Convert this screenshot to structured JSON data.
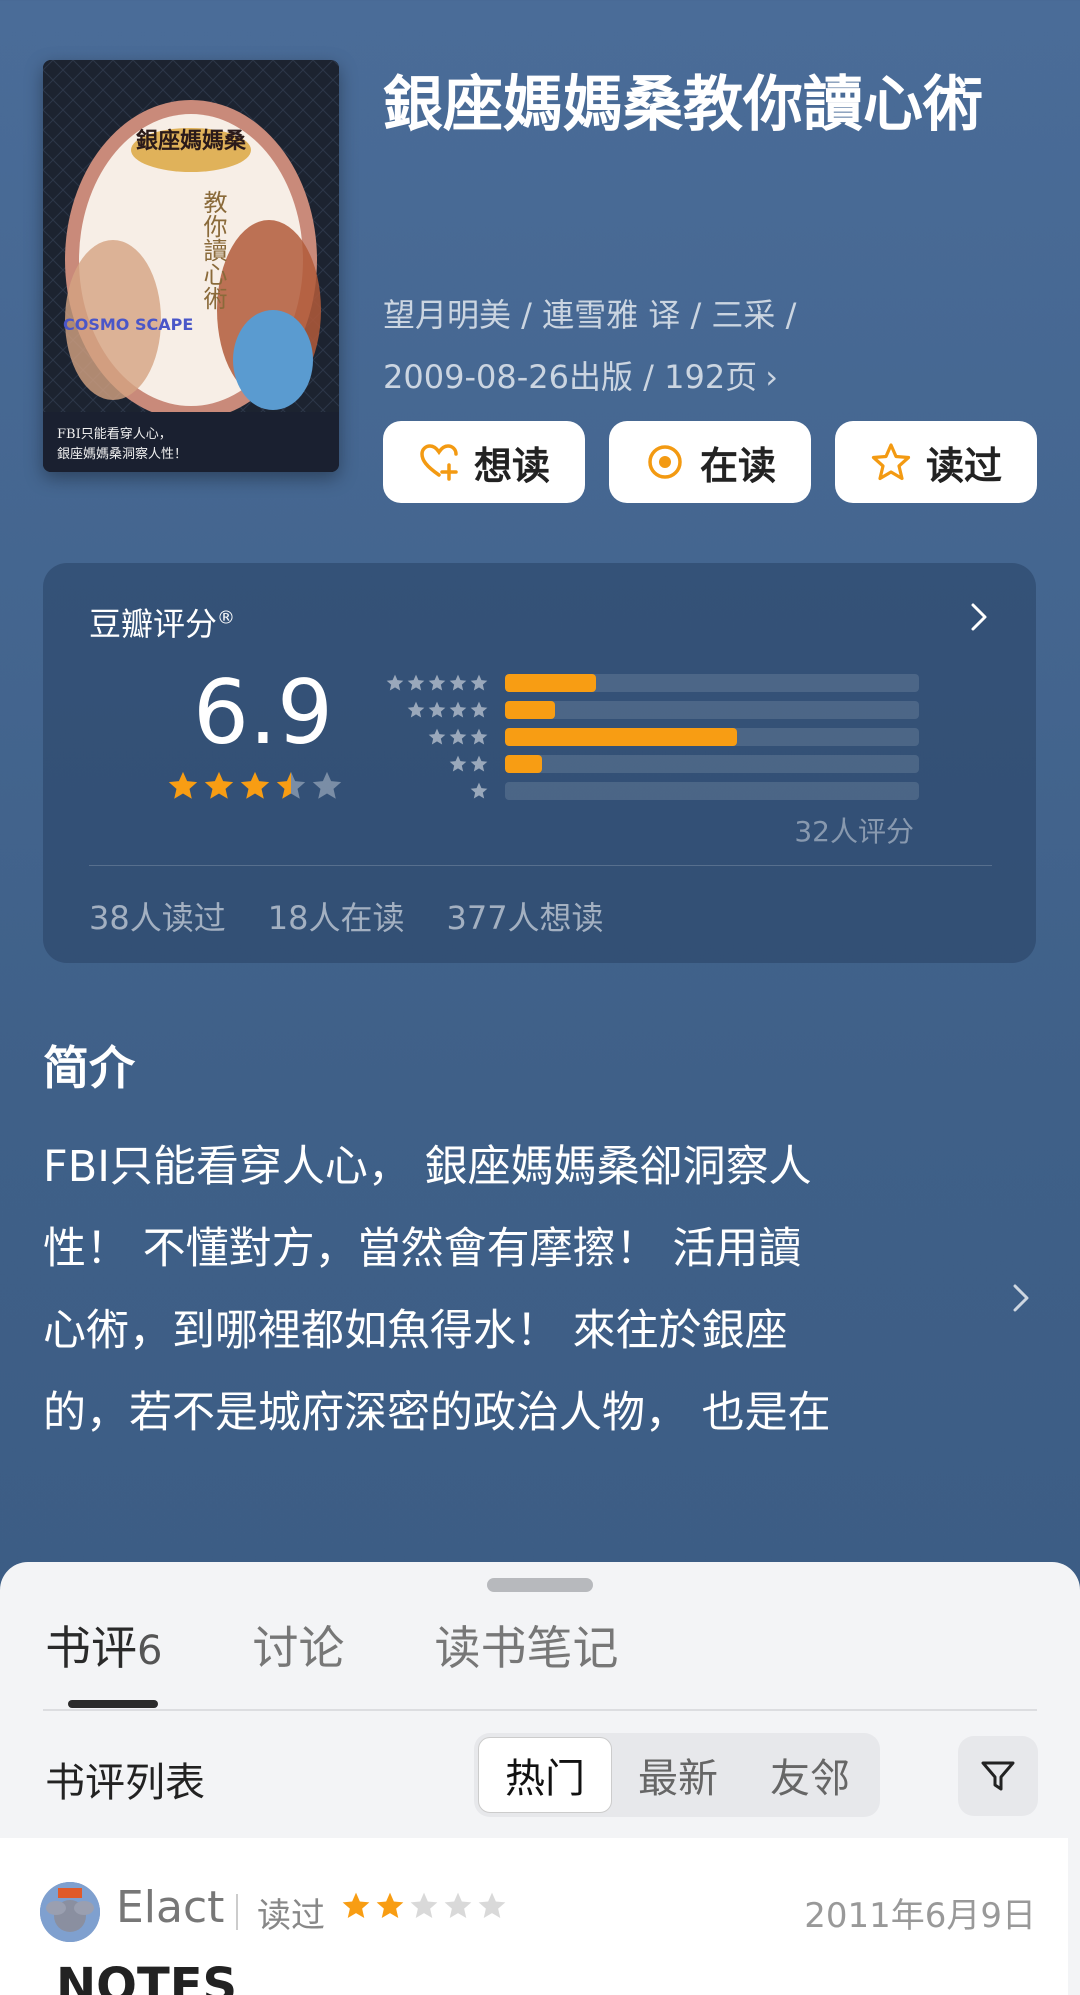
{
  "book": {
    "title": "銀座媽媽桑教你讀心術",
    "meta_line1": "望月明美 / 連雪雅 译 / 三采 /",
    "meta_line2": "2009-08-26出版 / 192页",
    "meta_chevron": "›",
    "cover": {
      "title_text": "銀座媽媽桑",
      "subtitle_text": "教你讀心術",
      "logo_text": "COSMO SCAPE",
      "tagline_line1": "FBI只能看穿人心，",
      "tagline_line2": "銀座媽媽桑洞察人性！"
    }
  },
  "actions": [
    {
      "label": "想读",
      "icon": "heart-plus-icon"
    },
    {
      "label": "在读",
      "icon": "target-icon"
    },
    {
      "label": "读过",
      "icon": "star-outline-icon"
    }
  ],
  "rating": {
    "label": "豆瓣评分",
    "registered_mark": "®",
    "score": "6.9",
    "score_stars": 3.5,
    "distribution": [
      {
        "stars": 5,
        "percent": 22
      },
      {
        "stars": 4,
        "percent": 12
      },
      {
        "stars": 3,
        "percent": 56
      },
      {
        "stars": 2,
        "percent": 9
      },
      {
        "stars": 1,
        "percent": 0
      }
    ],
    "count_text": "32人评分",
    "stats": [
      "38人读过",
      "18人在读",
      "377人想读"
    ]
  },
  "intro": {
    "heading": "简介",
    "lines": [
      "FBI只能看穿人心， 銀座媽媽桑卻洞察人",
      "性！ 不懂對方，當然會有摩擦！ 活用讀",
      "心術，到哪裡都如魚得水！ 來往於銀座",
      "的，若不是城府深密的政治人物， 也是在"
    ]
  },
  "sheet": {
    "tabs": [
      {
        "label": "书评",
        "count": "6"
      },
      {
        "label": "讨论",
        "count": ""
      },
      {
        "label": "读书笔记",
        "count": ""
      }
    ],
    "list_title": "书评列表",
    "sort_options": [
      "热门",
      "最新",
      "友邻"
    ],
    "review": {
      "user": "Elact",
      "status": "读过",
      "stars": 2,
      "date": "2011年6月9日",
      "title": "NOTES"
    }
  },
  "colors": {
    "accent_orange": "#f89d13",
    "background_blue": "#4a6c98"
  }
}
